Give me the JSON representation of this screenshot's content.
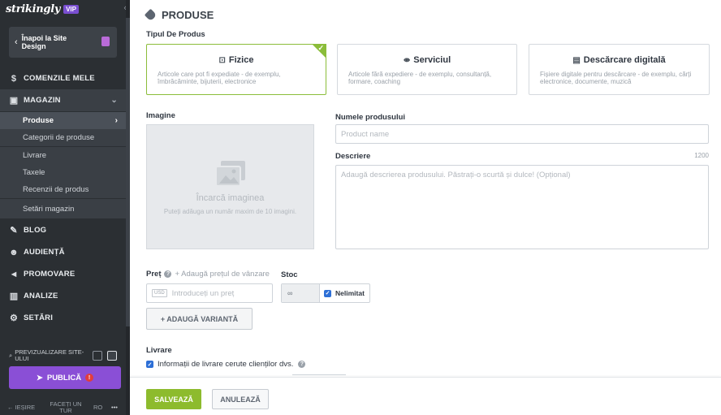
{
  "sidebar": {
    "logo": "strikingly",
    "badge": "VIP",
    "back_label": "Înapoi la Site Design",
    "nav": {
      "orders": "COMENZILE MELE",
      "store": "MAGAZIN",
      "blog": "BLOG",
      "audience": "AUDIENȚĂ",
      "promote": "PROMOVARE",
      "analytics": "ANALIZE",
      "settings": "SETĂRI"
    },
    "store_sub": [
      "Produse",
      "Categorii de produse",
      "Livrare",
      "Taxele",
      "Recenzii de produs",
      "Setări magazin"
    ],
    "preview_label": "PREVIZUALIZARE SITE-ULUI",
    "publish_label": "PUBLICĂ",
    "publish_warning": "!",
    "exit_label": "IEȘIRE",
    "feedback_label": "FACEȚI UN TUR",
    "lang": "RO",
    "more": "•••"
  },
  "main": {
    "title": "PRODUSE",
    "product_type_label": "Tipul De Produs",
    "types": [
      {
        "title": "Fizice",
        "desc": "Articole care pot fi expediate - de exemplu, îmbrăcăminte, bijuterii, electronice",
        "icon": "package-icon",
        "selected": true
      },
      {
        "title": "Serviciul",
        "desc": "Articole fără expediere - de exemplu, consultanță, formare, coaching",
        "icon": "dumbbell-icon",
        "selected": false
      },
      {
        "title": "Descărcare digitală",
        "desc": "Fișiere digitale pentru descărcare - de exemplu, cărți electronice, documente, muzică",
        "icon": "document-icon",
        "selected": false
      }
    ],
    "image_label": "Imagine",
    "image_upload_title": "Încarcă imaginea",
    "image_upload_sub": "Puteți adăuga un număr maxim de 10 imagini.",
    "name_label": "Numele produsului",
    "name_placeholder": "Product name",
    "desc_label": "Descriere",
    "desc_counter": "1200",
    "desc_placeholder": "Adaugă descrierea produsului. Păstrați-o scurtă și dulce! (Opțional)",
    "price_label": "Preț",
    "add_sale_price": "+ Adaugă prețul de vânzare",
    "currency": "USD",
    "price_placeholder": "Introduceți un preț",
    "stock_label": "Stoc",
    "stock_value": "∞",
    "unlimited_label": "Nelimitat",
    "add_variant": "+ ADAUGĂ VARIANTĂ",
    "shipping_label": "Livrare",
    "shipping_checkbox": "Informații de livrare cerute clienților dvs.",
    "save": "SALVEAZĂ",
    "cancel": "ANULEAZĂ"
  }
}
